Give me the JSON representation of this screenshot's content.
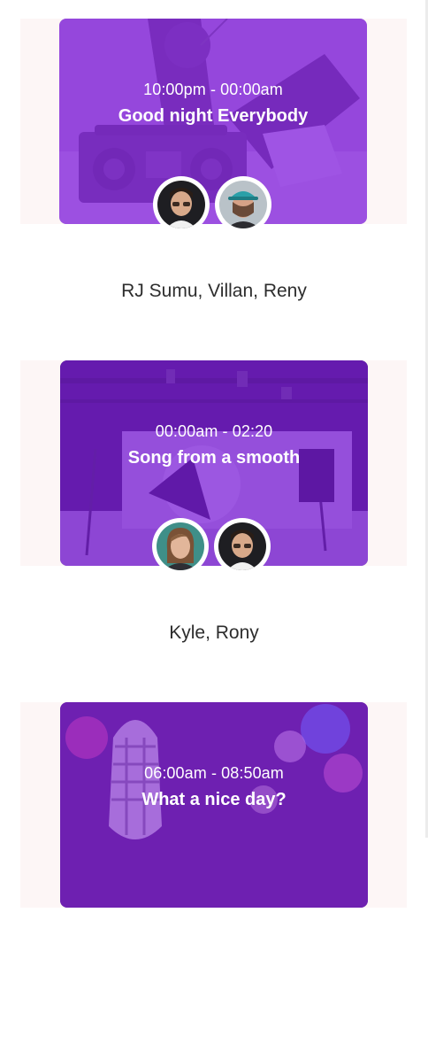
{
  "shows": [
    {
      "time": "10:00pm - 00:00am",
      "title": "Good night Everybody",
      "hosts": "RJ Sumu, Villan, Reny",
      "image_icon": "boombox-photo",
      "avatars": [
        "host-avatar-man-glasses",
        "host-avatar-man-cap"
      ]
    },
    {
      "time": "00:00am - 02:20",
      "title": "Song from a smooth",
      "hosts": "Kyle, Rony",
      "image_icon": "studio-photo",
      "avatars": [
        "host-avatar-woman",
        "host-avatar-man-glasses"
      ]
    },
    {
      "time": "06:00am - 08:50am",
      "title": "What a nice day?",
      "hosts": "",
      "image_icon": "microphone-photo",
      "avatars": []
    }
  ],
  "colors": {
    "overlay_purple": "#8a2be2",
    "band": "#fdf6f6",
    "text_dark": "#2d2d2d"
  }
}
